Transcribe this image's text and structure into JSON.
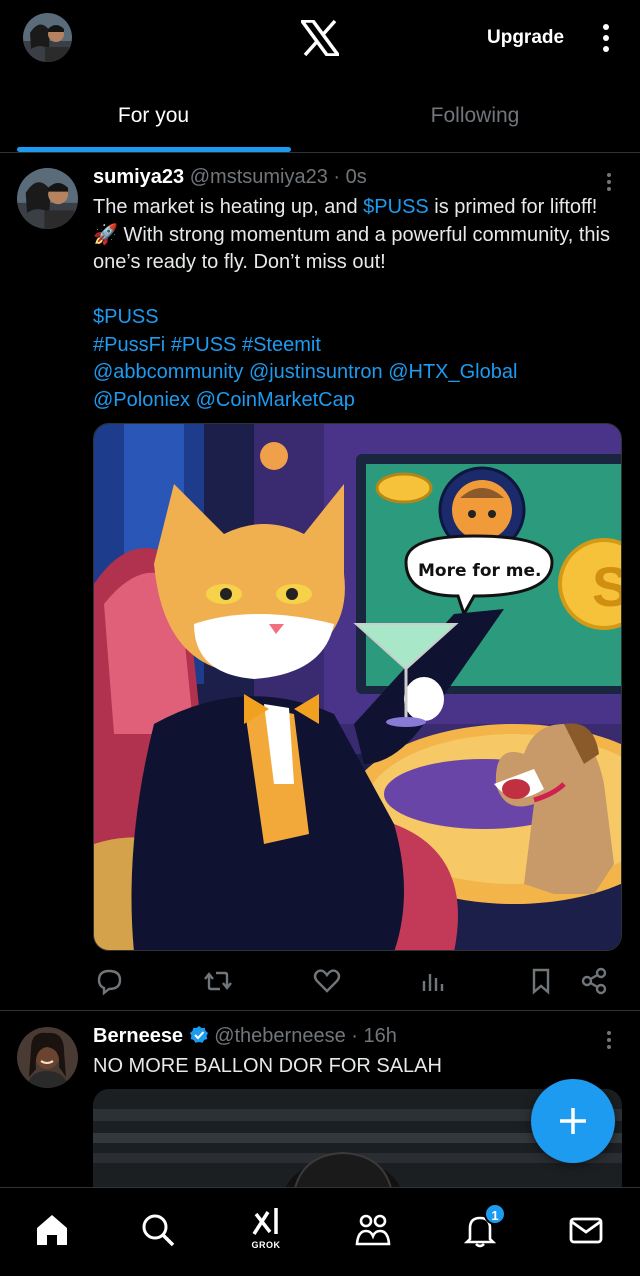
{
  "header": {
    "logo": "x-logo",
    "upgrade_label": "Upgrade"
  },
  "tabs": [
    {
      "label": "For you",
      "active": true
    },
    {
      "label": "Following",
      "active": false
    }
  ],
  "posts": [
    {
      "name": "sumiya23",
      "handle": "@mstsumiya23",
      "time": "· 0s",
      "text_a": "The market is heating up, and ",
      "text_cashtag": "$PUSS",
      "text_b": " is primed for liftoff! 🚀 With strong momentum and a powerful community, this one’s ready to fly. Don’t miss out!",
      "line_cashtag": "$PUSS",
      "hashtags": [
        "#PussFi",
        "#PUSS",
        "#Steemit"
      ],
      "mentions": [
        "@abbcommunity",
        "@justinsuntron",
        "@HTX_Global",
        "@Poloniex",
        "@CoinMarketCap"
      ],
      "image_speech": "More for me."
    },
    {
      "name": "Berneese",
      "verified": true,
      "handle": "@theberneese",
      "time": "· 16h",
      "text": "NO MORE BALLON DOR FOR SALAH"
    }
  ],
  "bottom_nav": {
    "items": [
      "home-icon",
      "search-icon",
      "grok-icon",
      "communities-icon",
      "notifications-icon",
      "messages-icon"
    ],
    "grok_label": "GROK",
    "notification_count": "1"
  },
  "colors": {
    "accent": "#1d9bf0",
    "background": "#000000",
    "muted": "#71767b"
  }
}
